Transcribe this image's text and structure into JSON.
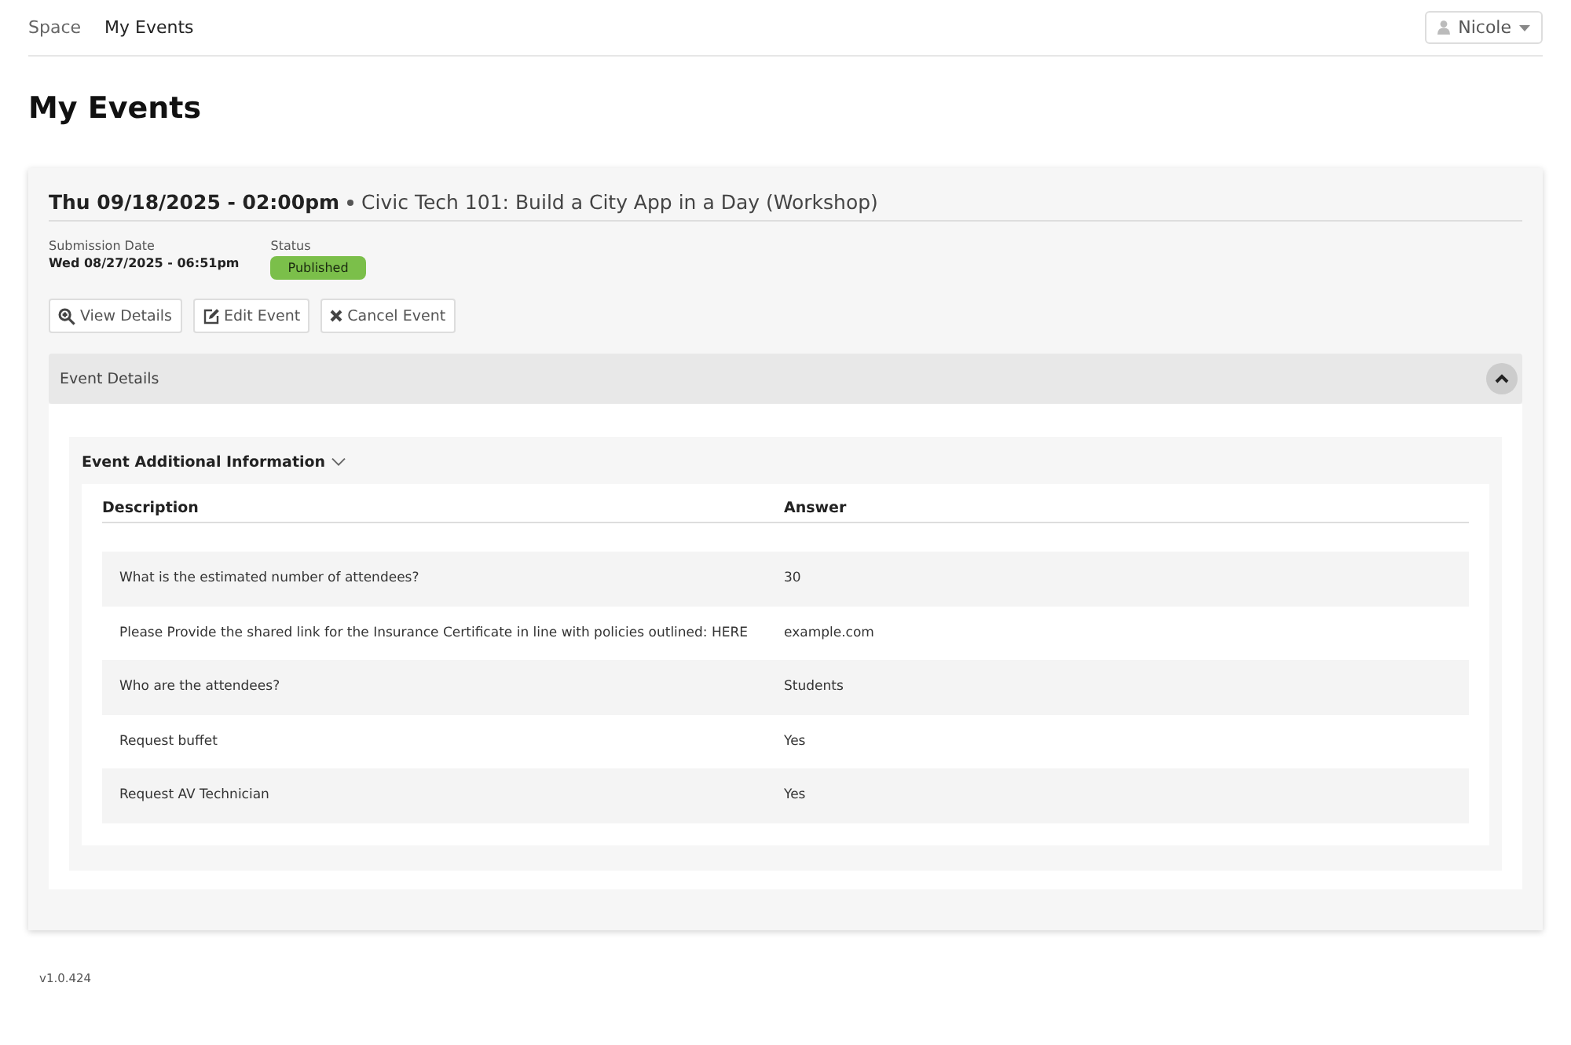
{
  "nav": {
    "items": [
      {
        "label": "Space",
        "selected": false
      },
      {
        "label": "My Events",
        "selected": true
      }
    ],
    "user": "Nicole"
  },
  "page_title": "My Events",
  "event": {
    "datetime": "Thu 09/18/2025 - 02:00pm",
    "name": "Civic Tech 101: Build a City App in a Day (Workshop)",
    "submission_label": "Submission Date",
    "submission_value": "Wed 08/27/2025 - 06:51pm",
    "status_label": "Status",
    "status": "Published",
    "actions": [
      {
        "kind": "view",
        "label": "View Details"
      },
      {
        "kind": "edit",
        "label": "Edit Event"
      },
      {
        "kind": "cancel",
        "label": "Cancel Event"
      }
    ],
    "details": {
      "title": "Event Details",
      "expanded": true,
      "section": {
        "title": "Event Additional Information",
        "expanded": true,
        "columns": [
          "Description",
          "Answer"
        ],
        "rows": [
          {
            "description": "What is the estimated number of attendees?",
            "answer": "30"
          },
          {
            "description": "Please Provide the shared link for the Insurance Certificate in line with policies outlined: HERE",
            "answer": "example.com"
          },
          {
            "description": "Who are the attendees?",
            "answer": "Students"
          },
          {
            "description": "Request buffet",
            "answer": "Yes"
          },
          {
            "description": "Request AV Technician",
            "answer": "Yes"
          }
        ]
      }
    }
  },
  "version": "v1.0.424"
}
